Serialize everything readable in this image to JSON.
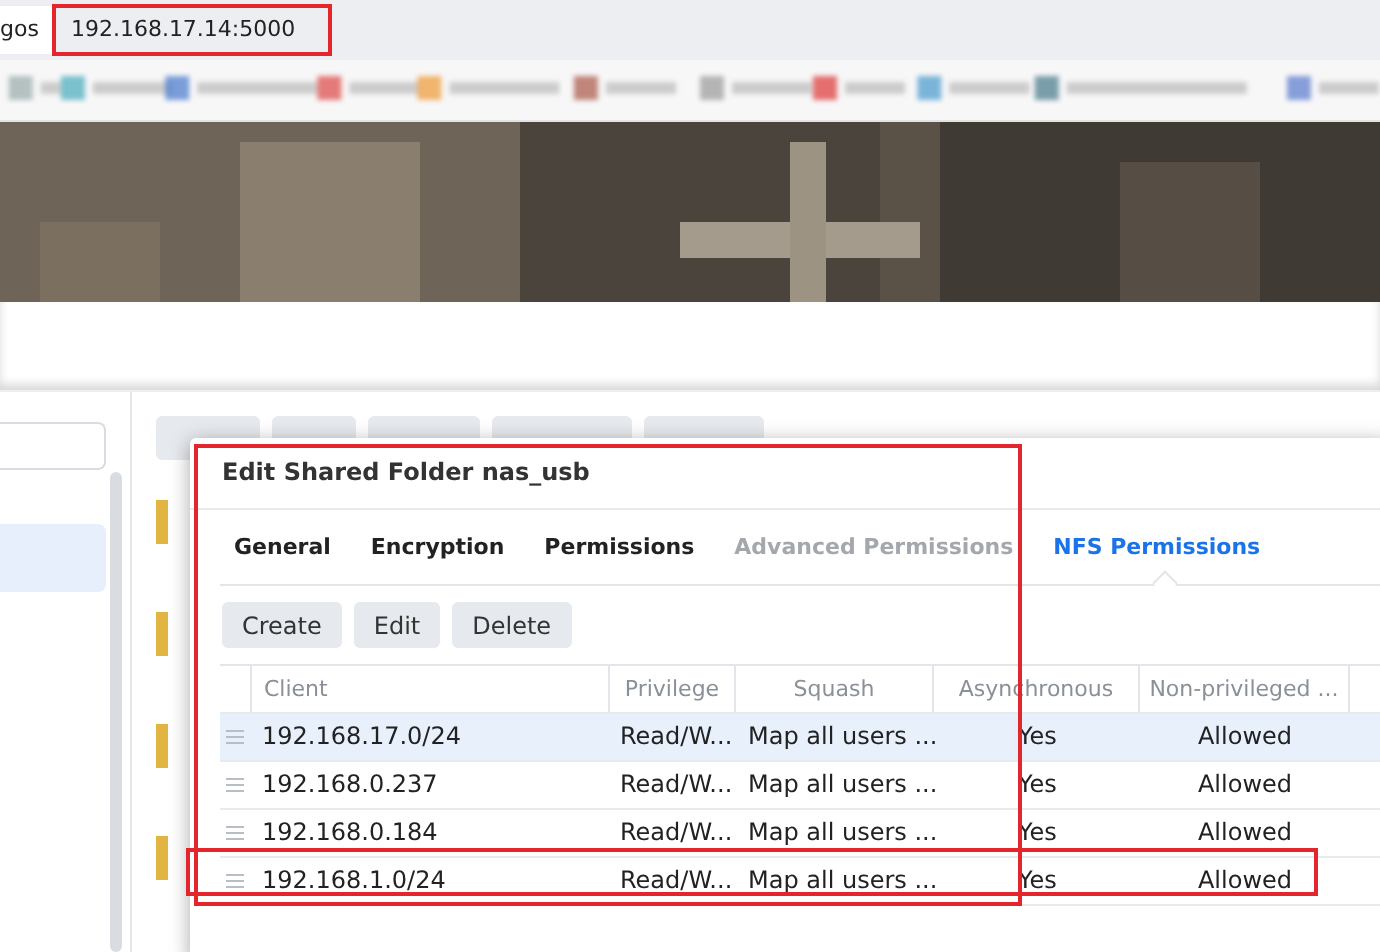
{
  "browser": {
    "tab_fragment": "gos",
    "address": "192.168.17.14:5000"
  },
  "toolbar": [
    {
      "kind": "button"
    },
    {
      "kind": "button"
    },
    {
      "kind": "button"
    },
    {
      "kind": "button"
    },
    {
      "kind": "button"
    }
  ],
  "dialog": {
    "title": "Edit Shared Folder nas_usb",
    "tabs": [
      {
        "label": "General",
        "selected": false,
        "disabled": false
      },
      {
        "label": "Encryption",
        "selected": false,
        "disabled": false
      },
      {
        "label": "Permissions",
        "selected": false,
        "disabled": false
      },
      {
        "label": "Advanced Permissions",
        "selected": false,
        "disabled": true
      },
      {
        "label": "NFS Permissions",
        "selected": true,
        "disabled": false
      }
    ],
    "buttons": [
      "Create",
      "Edit",
      "Delete"
    ],
    "table": {
      "columns": [
        "Client",
        "Privilege",
        "Squash",
        "Asynchronous",
        "Non-privileged ..."
      ],
      "rows": [
        {
          "selected": true,
          "cells": [
            "192.168.17.0/24",
            "Read/W...",
            "Map all users ...",
            "Yes",
            "Allowed"
          ]
        },
        {
          "selected": false,
          "cells": [
            "192.168.0.237",
            "Read/W...",
            "Map all users ...",
            "Yes",
            "Allowed"
          ]
        },
        {
          "selected": false,
          "cells": [
            "192.168.0.184",
            "Read/W...",
            "Map all users ...",
            "Yes",
            "Allowed"
          ]
        },
        {
          "selected": false,
          "cells": [
            "192.168.1.0/24",
            "Read/W...",
            "Map all users ...",
            "Yes",
            "Allowed"
          ]
        }
      ]
    }
  }
}
